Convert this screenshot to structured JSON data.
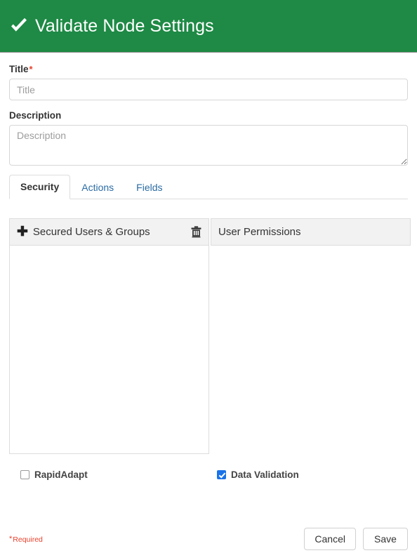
{
  "header": {
    "icon": "check-icon",
    "title": "Validate Node Settings",
    "background_color": "#1e8a45"
  },
  "form": {
    "title_field": {
      "label": "Title",
      "required_marker": "*",
      "placeholder": "Title",
      "value": ""
    },
    "description_field": {
      "label": "Description",
      "placeholder": "Description",
      "value": ""
    }
  },
  "tabs": [
    {
      "label": "Security",
      "active": true
    },
    {
      "label": "Actions",
      "active": false
    },
    {
      "label": "Fields",
      "active": false
    }
  ],
  "panels": {
    "left": {
      "add_icon": "plus-icon",
      "title": "Secured Users & Groups",
      "delete_icon": "trash-icon",
      "rows": []
    },
    "right": {
      "title": "User Permissions",
      "rows": []
    }
  },
  "checkboxes": [
    {
      "label": "RapidAdapt",
      "checked": false
    },
    {
      "label": "Data Validation",
      "checked": true,
      "color": "#1a73e8"
    }
  ],
  "footer": {
    "required_star": "*",
    "required_label": "Required",
    "required_color": "#e8412c",
    "cancel_label": "Cancel",
    "save_label": "Save"
  }
}
